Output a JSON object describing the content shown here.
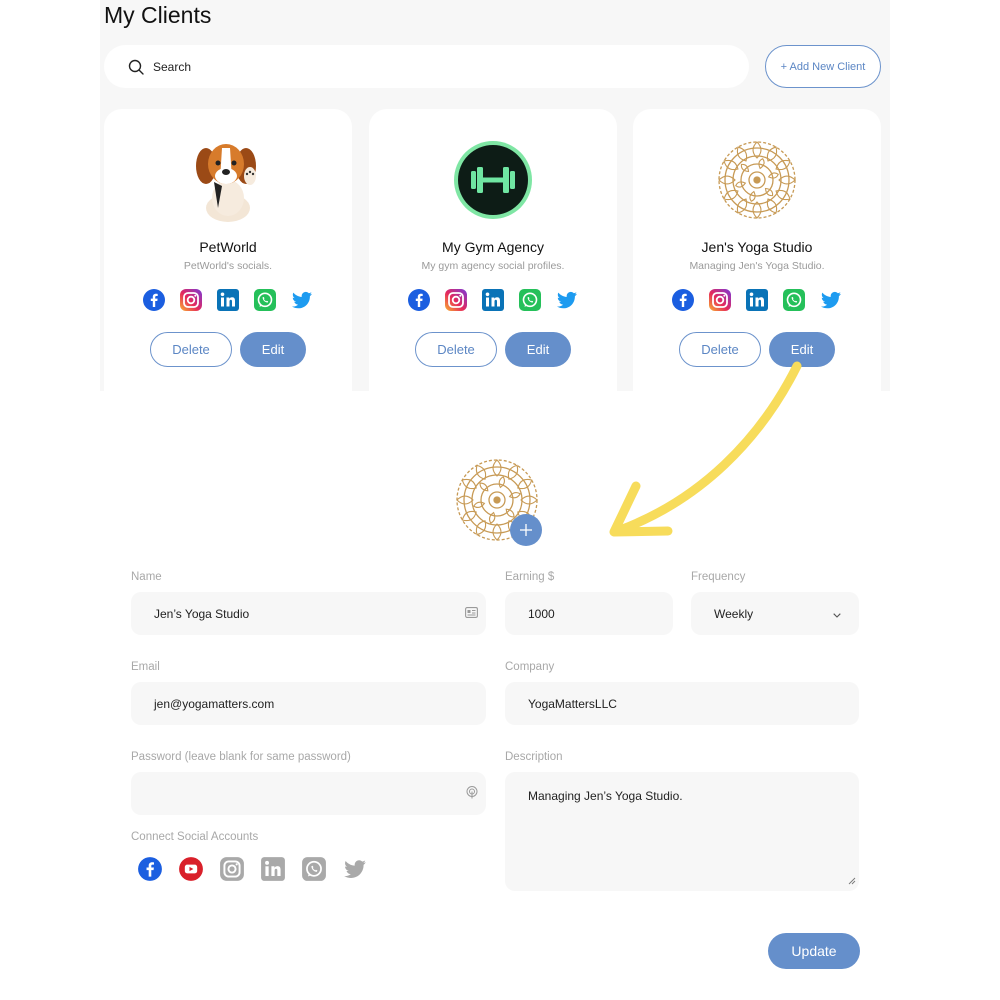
{
  "page": {
    "title": "My Clients"
  },
  "search": {
    "placeholder": "Search"
  },
  "add_client": {
    "label": "+ Add New Client"
  },
  "colors": {
    "accent": "#658fcb",
    "panel": "#f7f7f7",
    "arrow": "#f7dc5b"
  },
  "clients": [
    {
      "name": "PetWorld",
      "description": "PetWorld's socials.",
      "logo": "beagle-dog-logo",
      "delete_label": "Delete",
      "edit_label": "Edit"
    },
    {
      "name": "My Gym Agency",
      "description": "My gym agency social profiles.",
      "logo": "dumbbell-logo",
      "delete_label": "Delete",
      "edit_label": "Edit"
    },
    {
      "name": "Jen's Yoga Studio",
      "description": "Managing Jen's Yoga Studio.",
      "logo": "mandala-logo",
      "delete_label": "Delete",
      "edit_label": "Edit"
    }
  ],
  "card_socials": [
    "facebook-icon",
    "instagram-icon",
    "linkedin-icon",
    "whatsapp-icon",
    "twitter-icon"
  ],
  "form": {
    "name": {
      "label": "Name",
      "value": "Jen’s Yoga Studio"
    },
    "earning": {
      "label": "Earning $",
      "value": "1000"
    },
    "frequency": {
      "label": "Frequency",
      "value": "Weekly"
    },
    "email": {
      "label": "Email",
      "value": "jen@yogamatters.com"
    },
    "company": {
      "label": "Company",
      "value": "YogaMattersLLC"
    },
    "password": {
      "label": "Password (leave blank for same password)",
      "value": ""
    },
    "description": {
      "label": "Description",
      "value": "Managing Jen’s Yoga Studio."
    },
    "connect": {
      "label": "Connect Social Accounts",
      "accounts": [
        {
          "icon": "facebook-icon",
          "connected": true
        },
        {
          "icon": "youtube-icon",
          "connected": true
        },
        {
          "icon": "instagram-icon",
          "connected": false
        },
        {
          "icon": "linkedin-icon",
          "connected": false
        },
        {
          "icon": "whatsapp-icon",
          "connected": false
        },
        {
          "icon": "twitter-icon",
          "connected": false
        }
      ]
    },
    "update_label": "Update"
  }
}
